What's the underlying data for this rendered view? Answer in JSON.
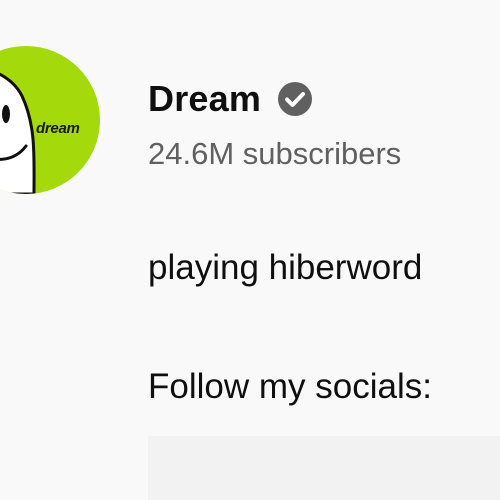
{
  "channel": {
    "avatar_text": "dream",
    "name": "Dream",
    "verified_icon": "verified-check-icon",
    "subscribers": "24.6M subscribers"
  },
  "description": {
    "line1": "playing hiberword",
    "line2": "Follow my socials:"
  },
  "colors": {
    "background": "#f9f9f9",
    "avatar_bg": "#a4d90b",
    "subtext": "#606060",
    "verified": "#606060"
  }
}
